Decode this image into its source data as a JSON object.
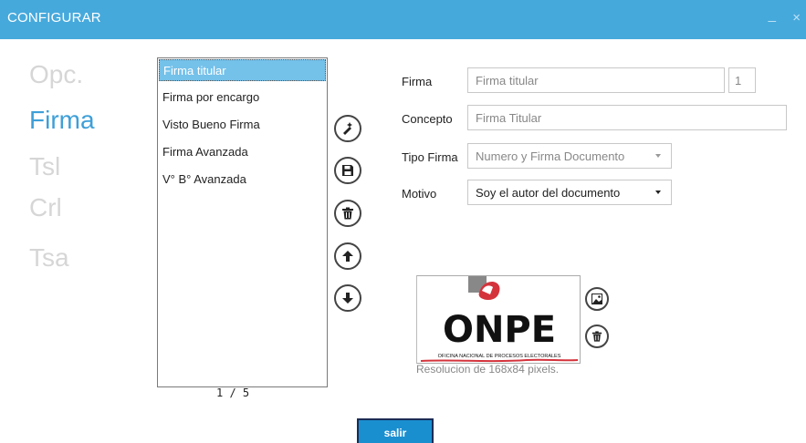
{
  "window": {
    "title": "CONFIGURAR",
    "minimize": "_",
    "close": "×"
  },
  "nav": {
    "items": [
      {
        "label": "Opc.",
        "active": false
      },
      {
        "label": "Firma",
        "active": true
      },
      {
        "label": "Tsl",
        "active": false
      },
      {
        "label": "Crl",
        "active": false
      },
      {
        "label": "Tsa",
        "active": false
      }
    ]
  },
  "signatures": {
    "items": [
      "Firma titular",
      "Firma por encargo",
      "Visto Bueno Firma",
      "Firma Avanzada",
      "V° B° Avanzada"
    ],
    "selected_index": 0,
    "pager": "1 / 5"
  },
  "form": {
    "firma_label": "Firma",
    "firma_value": "Firma titular",
    "firma_number": "1",
    "concepto_label": "Concepto",
    "concepto_value": "Firma Titular",
    "tipo_label": "Tipo Firma",
    "tipo_value": "Numero y Firma Documento",
    "motivo_label": "Motivo",
    "motivo_value": "Soy el autor del documento"
  },
  "image": {
    "logo_text": "ONPE",
    "logo_subtext": "OFICINA NACIONAL DE PROCESOS ELECTORALES",
    "resolution_text": "Resolucion de 168x84 pixels."
  },
  "actions": {
    "exit_label": "salir"
  },
  "colors": {
    "titlebar": "#46a9dc",
    "accent": "#3e9fd8",
    "selected": "#74c1ea",
    "button": "#1a8fd0"
  },
  "icons": [
    "edit-icon",
    "save-icon",
    "delete-icon",
    "arrow-up-icon",
    "arrow-down-icon",
    "image-icon",
    "trash-icon"
  ]
}
